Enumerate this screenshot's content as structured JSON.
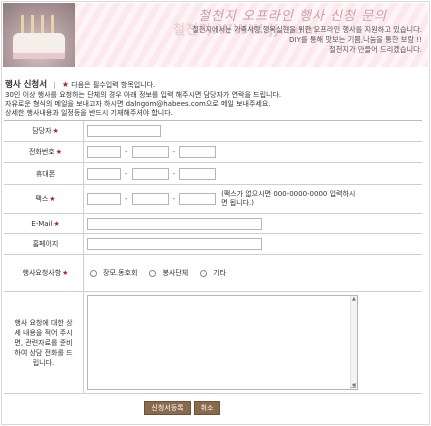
{
  "banner": {
    "title": "철천지 오프라인 행사 신청 문의",
    "watermark": "철천지.WWW.jj.com",
    "lines": [
      "철천지에서는 가족사랑,행복실현을 위한 오프라인 행사를 지원하고 있습니다.",
      "DIY를 통해 맛보는 기쁨,나눔을 통한 보람 !!",
      "철천지가 만들어 드리겠습니다."
    ]
  },
  "form": {
    "title": "행사 신청서",
    "separator": "|",
    "required_star": "★",
    "required_note": "다음은 필수입력 항목입니다.",
    "intro": [
      "30인 이상 행사를 요청하는 단체의 경우 아래 정보를 입력 해주시면 담당자가 연락을 드립니다.",
      "자유로운 형식의 메일을 보내고자 하시면 dalngom@habees.com으로 메일 보내주세요.",
      "상세한 행사내용과 일정등을 반드시 기재해주셔야 합니다."
    ],
    "fields": {
      "manager": {
        "label": "담당자",
        "star": "★"
      },
      "phone": {
        "label": "전화번호",
        "star": "★",
        "dash": "-"
      },
      "mobile": {
        "label": "휴대폰",
        "dash": "-"
      },
      "fax": {
        "label": "팩스",
        "star": "★",
        "dash": "-",
        "note": "(팩스가 없으시면 000-0000-0000 입력하시면 됩니다.)"
      },
      "email": {
        "label": "E-Mail",
        "star": "★"
      },
      "homepage": {
        "label": "홈페이지"
      },
      "event_type": {
        "label": "행사요청사항",
        "star": "★",
        "options": [
          "장모.동호회",
          "봉사단체",
          "기타"
        ]
      },
      "detail": {
        "label": "행사 요청에 대한 상세 내용을 적어 주시면, 관련자료를 준비하여 상담 전화를 드립니다."
      }
    }
  },
  "buttons": {
    "submit": "신청서등록",
    "cancel": "취소"
  },
  "colors": {
    "star": "#b3261e",
    "button": "#8a6a4c",
    "banner_pink": "#fbe9ee"
  }
}
